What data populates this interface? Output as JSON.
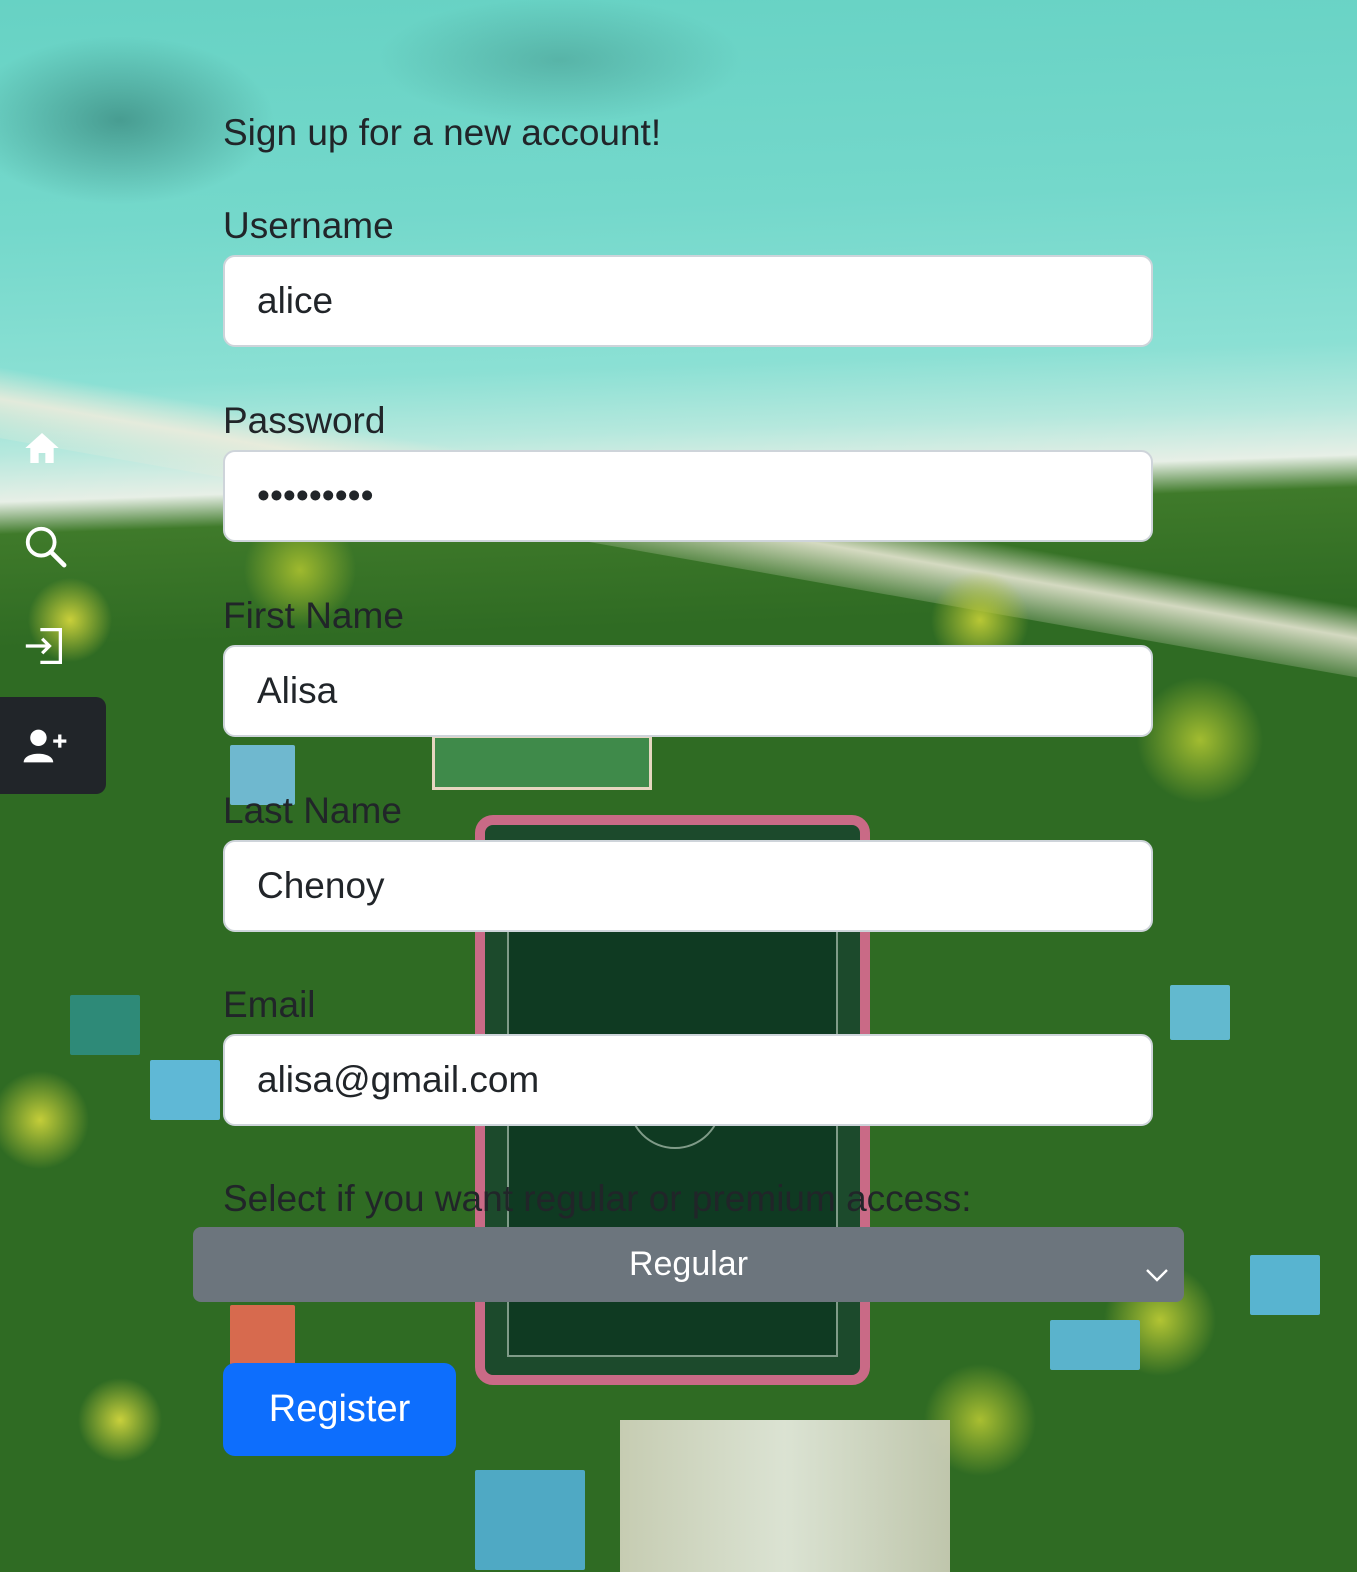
{
  "nav": {
    "items": [
      {
        "icon": "home-icon"
      },
      {
        "icon": "search-icon"
      },
      {
        "icon": "login-icon"
      },
      {
        "icon": "add-user-icon",
        "active": true
      }
    ],
    "active_background": "#212529"
  },
  "form": {
    "heading": "Sign up for a new account!",
    "username": {
      "label": "Username",
      "value": "alice"
    },
    "password": {
      "label": "Password",
      "value": "•••••••••"
    },
    "first_name": {
      "label": "First Name",
      "value": "Alisa"
    },
    "last_name": {
      "label": "Last Name",
      "value": "Chenoy"
    },
    "email": {
      "label": "Email",
      "value": "alisa@gmail.com"
    },
    "access": {
      "label": "Select if you want regular or premium access:",
      "selected": "Regular",
      "background": "#6c757d"
    },
    "submit_label": "Register",
    "submit_color": "#0d6efd"
  }
}
